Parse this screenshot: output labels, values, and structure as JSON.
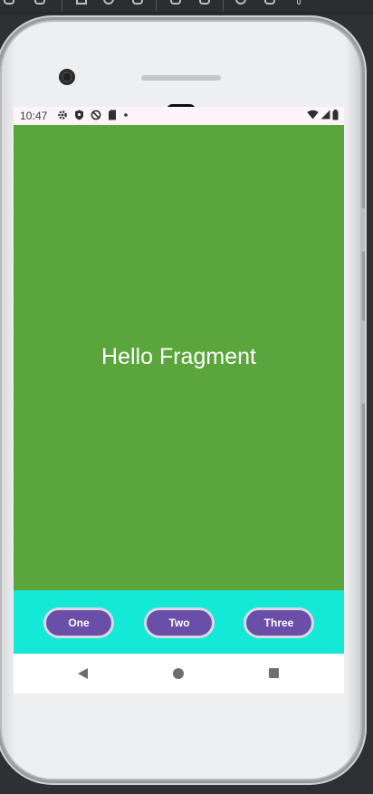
{
  "status_bar": {
    "time": "10:47",
    "left_icons": [
      "settings-icon",
      "shield-icon",
      "sync-disabled-icon",
      "sd-card-icon",
      "dot-icon"
    ],
    "right_icons": [
      "wifi-icon",
      "cellular-signal-icon",
      "battery-icon"
    ]
  },
  "fragment": {
    "text": "Hello Fragment",
    "background_color": "#5ba63c"
  },
  "bottom_bar": {
    "background_color": "#14e8d6",
    "buttons": [
      {
        "label": "One"
      },
      {
        "label": "Two"
      },
      {
        "label": "Three"
      }
    ]
  },
  "nav_bar": {
    "buttons": [
      "back-icon",
      "home-icon",
      "recents-icon"
    ]
  },
  "colors": {
    "button_fill": "#6a4fa8",
    "button_border": "#dcd7e6",
    "status_bar_bg": "#fdf4fb"
  }
}
